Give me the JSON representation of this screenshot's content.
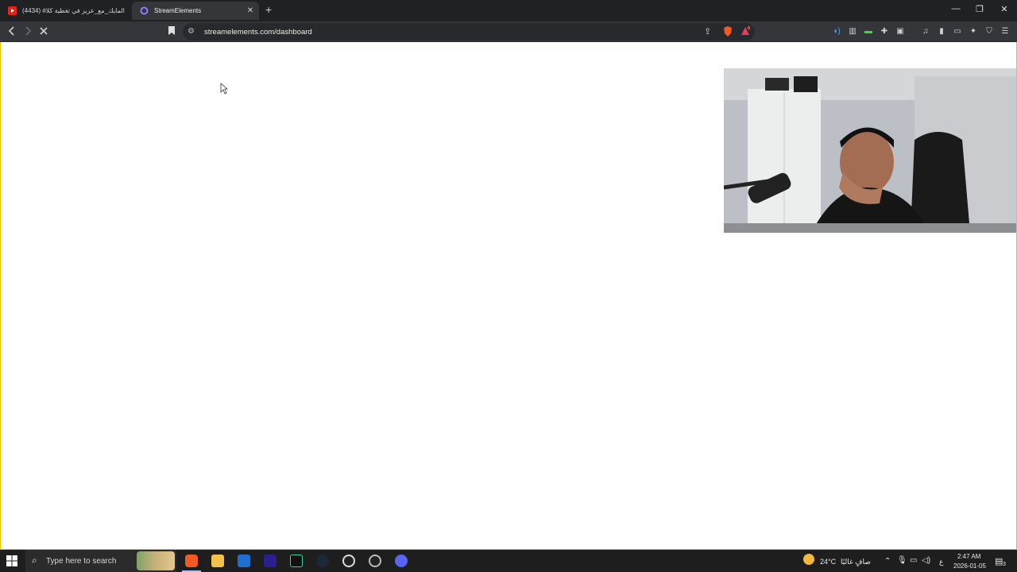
{
  "browser": {
    "tabs": [
      {
        "title": "(4434) #المايك_مع_عزيز في تغطية كلا",
        "active": false
      },
      {
        "title": "StreamElements",
        "active": true
      }
    ],
    "new_tab": "+",
    "address": "streamelements.com/dashboard",
    "window_controls": {
      "minimize": "—",
      "restore": "❐",
      "close": "✕"
    }
  },
  "taskbar": {
    "search_placeholder": "Type here to search",
    "weather": {
      "temp": "24°C",
      "condition": "صافٍ غالبًا"
    },
    "input_language": "ع",
    "time": "2:47 AM",
    "date": "2026-01-05",
    "notification_count": "3"
  },
  "colors": {
    "frame_border": "#e8c800",
    "taskbar": "#1e1e1e",
    "toolbar": "#35363a"
  }
}
